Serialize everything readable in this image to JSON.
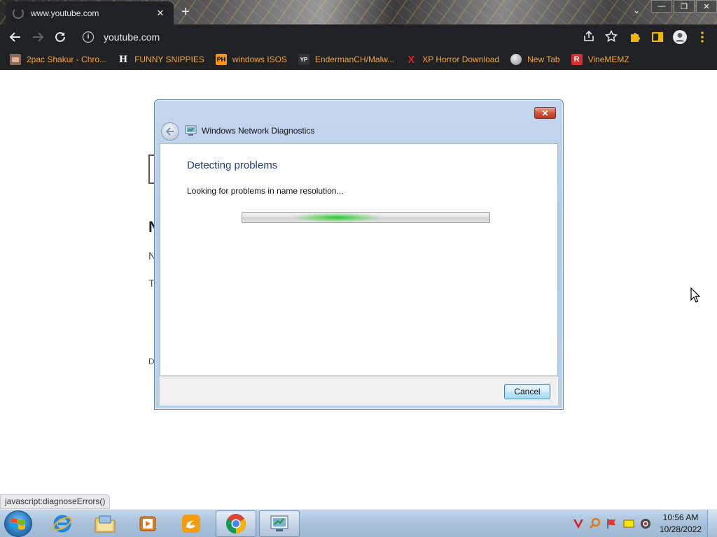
{
  "browser": {
    "tab": {
      "title": "www.youtube.com",
      "close_glyph": "✕",
      "favicon": "loading-spinner-icon"
    },
    "new_tab_glyph": "+",
    "window_controls": {
      "minimize": "—",
      "maximize": "❐",
      "close": "✕"
    },
    "tab_search_glyph": "⌄",
    "toolbar": {
      "url": "youtube.com"
    },
    "bookmarks": [
      {
        "label": "2pac Shakur - Chro...",
        "icon": "photo-icon"
      },
      {
        "label": "FUNNY SNIPPIES",
        "icon": "H"
      },
      {
        "label": "windows ISOS",
        "icon": "PH"
      },
      {
        "label": "EndermanCH/Malw...",
        "icon": "YP"
      },
      {
        "label": "XP Horror Download",
        "icon": "X"
      },
      {
        "label": "New Tab",
        "icon": "globe-icon"
      },
      {
        "label": "VineMEMZ",
        "icon": "R"
      }
    ],
    "page_fragments": {
      "n_heading": "N",
      "n_text": "N",
      "t_text": "T",
      "d_text": "D"
    },
    "status_url": "javascript:diagnoseErrors()"
  },
  "dialog": {
    "window_title": "Windows Network Diagnostics",
    "heading": "Detecting problems",
    "status": "Looking for problems in name resolution...",
    "cancel_label": "Cancel",
    "close_glyph": "✕",
    "progress_style": "indeterminate-marquee"
  },
  "taskbar": {
    "pinned": [
      "internet-explorer-icon",
      "file-explorer-icon",
      "media-player-icon",
      "uc-browser-icon",
      "chrome-icon",
      "network-diagnostics-icon"
    ],
    "tray": [
      "v-antivirus-icon",
      "search-magnifier-icon",
      "action-center-flag-icon",
      "yellow-tray-icon",
      "volume-icon"
    ],
    "clock": {
      "time": "10:56 AM",
      "date": "10/28/2022"
    }
  },
  "colors": {
    "chrome_dark": "#202124",
    "bookmark_text": "#f4a63a",
    "dialog_heading": "#1f3f7a",
    "taskbar": "#a9c1db"
  }
}
